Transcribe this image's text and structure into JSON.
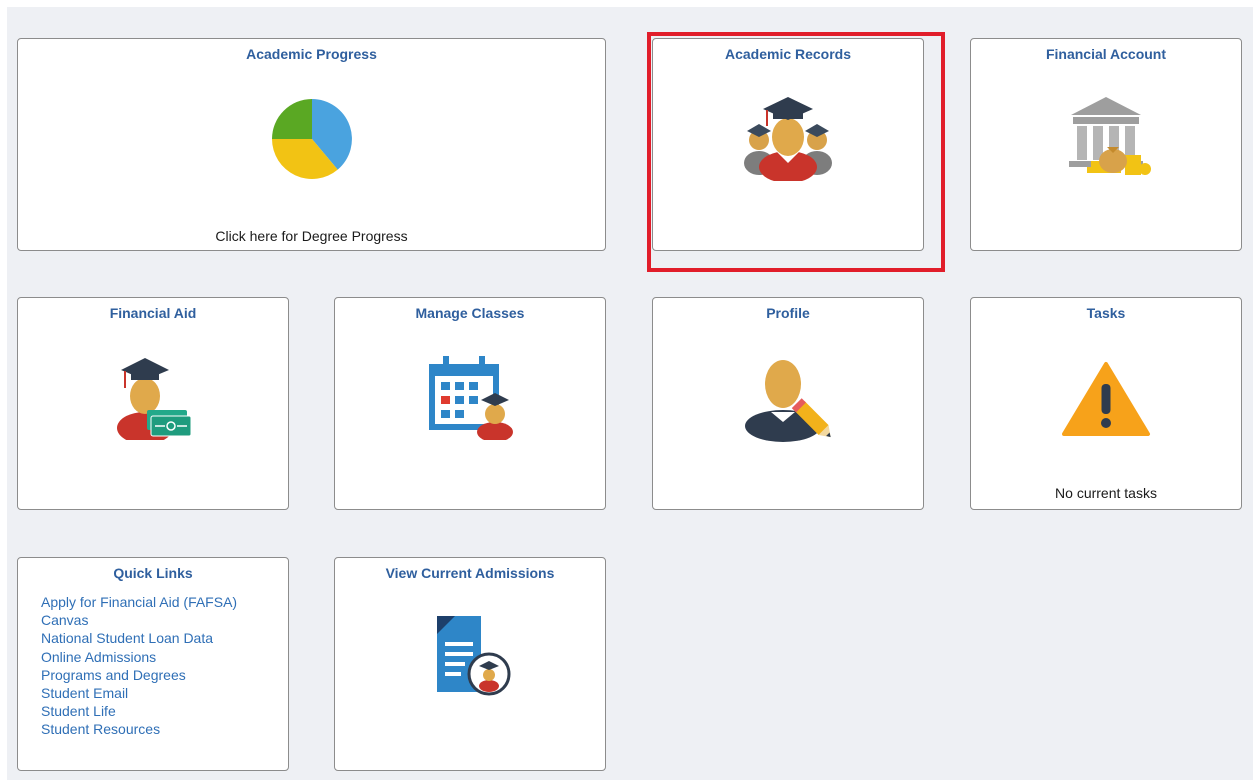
{
  "tiles": {
    "academic_progress": {
      "title": "Academic Progress",
      "caption": "Click here for Degree Progress",
      "icon": "pie-chart-icon"
    },
    "academic_records": {
      "title": "Academic Records",
      "icon": "graduates-group-icon"
    },
    "financial_account": {
      "title": "Financial Account",
      "icon": "bank-money-icon"
    },
    "financial_aid": {
      "title": "Financial Aid",
      "icon": "graduate-with-cash-icon"
    },
    "manage_classes": {
      "title": "Manage Classes",
      "icon": "calendar-graduate-icon"
    },
    "profile": {
      "title": "Profile",
      "icon": "person-edit-icon"
    },
    "tasks": {
      "title": "Tasks",
      "caption": "No current tasks",
      "icon": "warning-icon"
    },
    "quick_links": {
      "title": "Quick Links",
      "links": [
        "Apply for Financial Aid (FAFSA)",
        "Canvas",
        "National Student Loan Data",
        "Online Admissions",
        "Programs and Degrees",
        "Student Email",
        "Student Life",
        "Student Resources"
      ]
    },
    "view_current_admissions": {
      "title": "View Current Admissions",
      "icon": "admissions-document-icon"
    }
  },
  "colors": {
    "title_blue": "#2f5f9e",
    "link_blue": "#2f6fb6",
    "highlight_red": "#e11d2a",
    "background": "#eef0f4"
  }
}
